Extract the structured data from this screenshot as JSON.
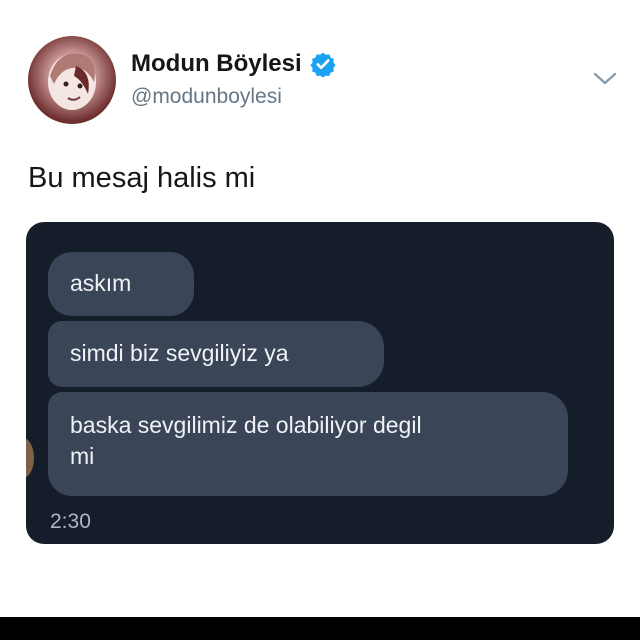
{
  "profile": {
    "display_name": "Modun Böylesi",
    "handle": "@modunboylesi",
    "verified": true,
    "verified_color": "#1da1f2",
    "avatar_icon": "avatar"
  },
  "tweet": {
    "text": "Bu mesaj halis mi"
  },
  "screenshot": {
    "background": "#161d2a",
    "bubble_color": "#3a4558",
    "messages": [
      {
        "lines": [
          "askım"
        ]
      },
      {
        "lines": [
          "simdi biz sevgiliyiz ya"
        ]
      },
      {
        "lines": [
          "baska sevgilimiz de olabiliyor degil",
          "mi"
        ]
      }
    ],
    "time": "2:30"
  },
  "icons": {
    "menu": "chevron-down-icon",
    "verified": "verified-badge-icon"
  }
}
